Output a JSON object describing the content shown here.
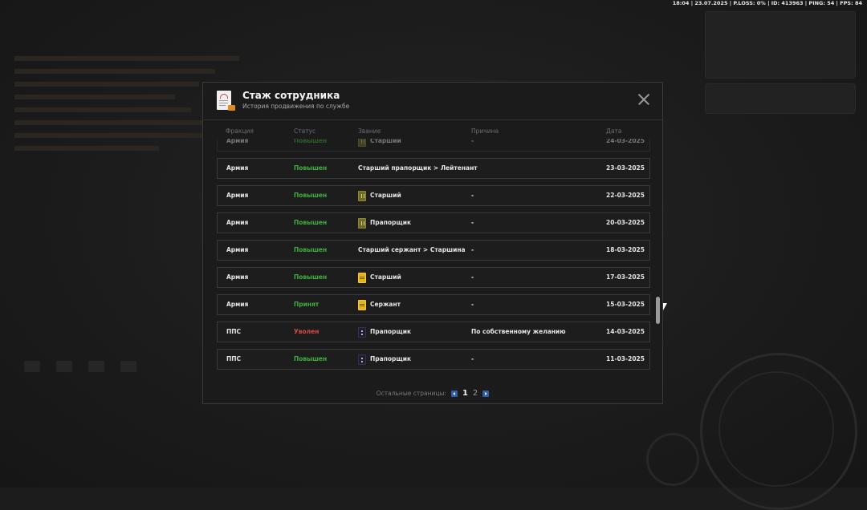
{
  "status_bar": "18:04 | 23.07.2025 | P.LOSS: 0% | ID: 413963 | PING: 54 | FPS: 84",
  "modal": {
    "title": "Стаж сотрудника",
    "subtitle": "История продвижения по службе",
    "columns": [
      "Фракция",
      "Статус",
      "Звание",
      "Причина",
      "Дата"
    ],
    "rows": [
      {
        "faction": "Армия",
        "status": "Повышен",
        "status_type": "up",
        "rank": "Старший",
        "rank_icon": "olive",
        "reason": "-",
        "date": "24-03-2025",
        "faded": true
      },
      {
        "faction": "Армия",
        "status": "Повышен",
        "status_type": "up",
        "rank": "Старший прапорщик > Лейтенант",
        "rank_icon": "",
        "reason": "-",
        "date": "23-03-2025",
        "faded": false
      },
      {
        "faction": "Армия",
        "status": "Повышен",
        "status_type": "up",
        "rank": "Старший",
        "rank_icon": "olive",
        "reason": "-",
        "date": "22-03-2025",
        "faded": false
      },
      {
        "faction": "Армия",
        "status": "Повышен",
        "status_type": "up",
        "rank": "Прапорщик",
        "rank_icon": "olive",
        "reason": "-",
        "date": "20-03-2025",
        "faded": false
      },
      {
        "faction": "Армия",
        "status": "Повышен",
        "status_type": "up",
        "rank": "Старший сержант > Старшина",
        "rank_icon": "",
        "reason": "-",
        "date": "18-03-2025",
        "faded": false
      },
      {
        "faction": "Армия",
        "status": "Повышен",
        "status_type": "up",
        "rank": "Старший",
        "rank_icon": "gold",
        "reason": "-",
        "date": "17-03-2025",
        "faded": false
      },
      {
        "faction": "Армия",
        "status": "Принят",
        "status_type": "acc",
        "rank": "Сержант",
        "rank_icon": "gold",
        "reason": "-",
        "date": "15-03-2025",
        "faded": false
      },
      {
        "faction": "ППС",
        "status": "Уволен",
        "status_type": "fired",
        "rank": "Прапорщик",
        "rank_icon": "navy",
        "reason": "По собственному желанию",
        "date": "14-03-2025",
        "faded": false
      },
      {
        "faction": "ППС",
        "status": "Повышен",
        "status_type": "up",
        "rank": "Прапорщик",
        "rank_icon": "navy",
        "reason": "-",
        "date": "11-03-2025",
        "faded": false
      }
    ],
    "pager": {
      "label": "Остальные страницы:",
      "pages": [
        "1",
        "2"
      ],
      "current": "1"
    }
  },
  "icons": {
    "document": "document-icon",
    "close": "close-icon",
    "prev": "chevron-left-icon",
    "next": "chevron-right-icon"
  }
}
